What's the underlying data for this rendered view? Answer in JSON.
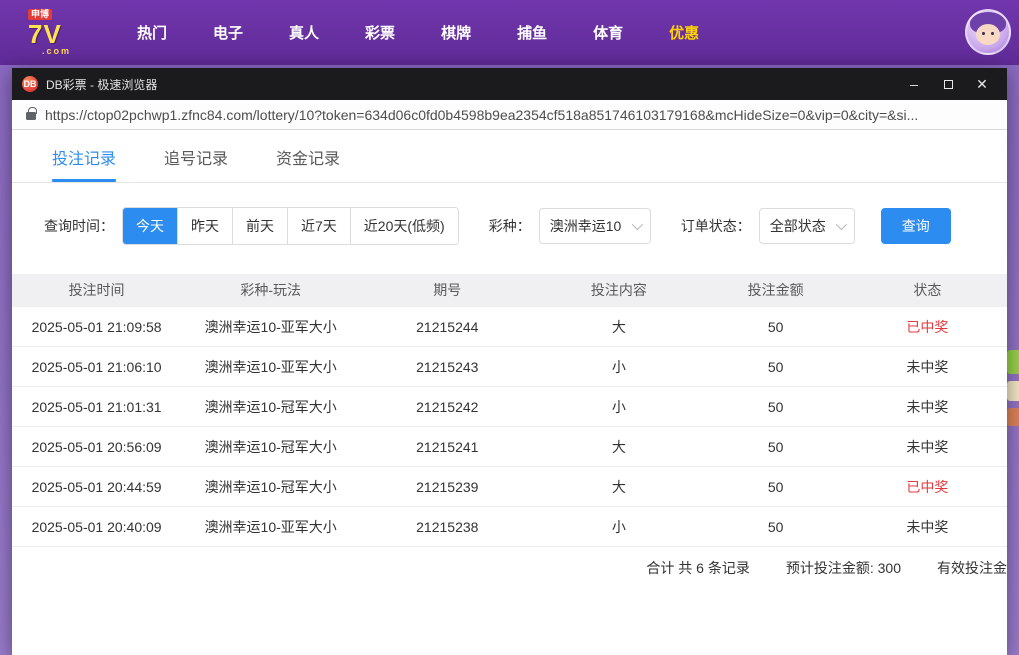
{
  "topnav": {
    "logo": {
      "top": "申博",
      "main": "7V",
      "com": ".com"
    },
    "items": [
      {
        "label": "热门"
      },
      {
        "label": "电子"
      },
      {
        "label": "真人"
      },
      {
        "label": "彩票"
      },
      {
        "label": "棋牌"
      },
      {
        "label": "捕鱼"
      },
      {
        "label": "体育"
      },
      {
        "label": "优惠",
        "highlight": true
      }
    ]
  },
  "window": {
    "title": "DB彩票 - 极速浏览器",
    "app_icon": "DB",
    "minimize": "–",
    "maximize": "",
    "close": "✕",
    "url": "https://ctop02pchwp1.zfnc84.com/lottery/10?token=634d06c0fd0b4598b9ea2354cf518a851746103179168&mcHideSize=0&vip=0&city=&si..."
  },
  "tabs": [
    {
      "label": "投注记录",
      "active": true
    },
    {
      "label": "追号记录",
      "active": false
    },
    {
      "label": "资金记录",
      "active": false
    }
  ],
  "filters": {
    "time_label": "查询时间：",
    "time_options": [
      {
        "label": "今天",
        "active": true
      },
      {
        "label": "昨天",
        "active": false
      },
      {
        "label": "前天",
        "active": false
      },
      {
        "label": "近7天",
        "active": false
      },
      {
        "label": "近20天(低频)",
        "active": false
      }
    ],
    "lottery_label": "彩种：",
    "lottery_value": "澳洲幸运10",
    "status_label": "订单状态：",
    "status_value": "全部状态",
    "search_button": "查询"
  },
  "table": {
    "headers": [
      "投注时间",
      "彩种-玩法",
      "期号",
      "投注内容",
      "投注金额",
      "状态"
    ],
    "rows": [
      {
        "time": "2025-05-01 21:09:58",
        "game": "澳洲幸运10-亚军大小",
        "issue": "21215244",
        "content": "大",
        "amount": "50",
        "status": "已中奖",
        "won": true
      },
      {
        "time": "2025-05-01 21:06:10",
        "game": "澳洲幸运10-亚军大小",
        "issue": "21215243",
        "content": "小",
        "amount": "50",
        "status": "未中奖",
        "won": false
      },
      {
        "time": "2025-05-01 21:01:31",
        "game": "澳洲幸运10-冠军大小",
        "issue": "21215242",
        "content": "小",
        "amount": "50",
        "status": "未中奖",
        "won": false
      },
      {
        "time": "2025-05-01 20:56:09",
        "game": "澳洲幸运10-冠军大小",
        "issue": "21215241",
        "content": "大",
        "amount": "50",
        "status": "未中奖",
        "won": false
      },
      {
        "time": "2025-05-01 20:44:59",
        "game": "澳洲幸运10-冠军大小",
        "issue": "21215239",
        "content": "大",
        "amount": "50",
        "status": "已中奖",
        "won": true
      },
      {
        "time": "2025-05-01 20:40:09",
        "game": "澳洲幸运10-亚军大小",
        "issue": "21215238",
        "content": "小",
        "amount": "50",
        "status": "未中奖",
        "won": false
      }
    ],
    "summary": {
      "total": "合计 共 6 条记录",
      "expected": "预计投注金额: 300",
      "valid": "有效投注金"
    }
  },
  "colors": {
    "accent_blue": "#2d8cf0",
    "won_red": "#e4393c",
    "nav_purple": "#6a2fa5",
    "highlight_yellow": "#ffd200",
    "titlebar_dark": "#1b1b1d",
    "table_header_bg": "#f0f0f2"
  }
}
